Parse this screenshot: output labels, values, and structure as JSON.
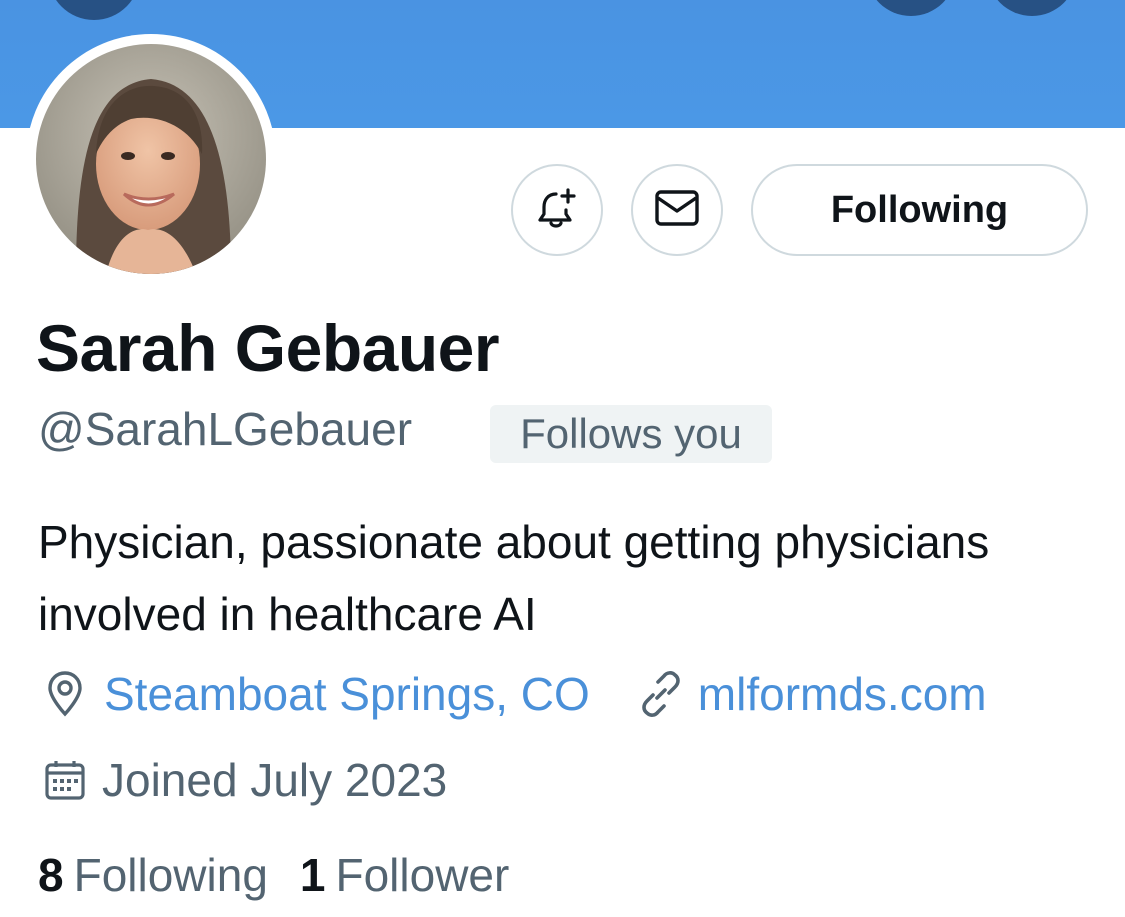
{
  "profile": {
    "name": "Sarah Gebauer",
    "handle": "@SarahLGebauer",
    "follows_you_badge": "Follows you",
    "bio": "Physician, passionate about getting physicians involved in healthcare AI",
    "location": "Steamboat Springs, CO",
    "website": "mlformds.com",
    "joined": "Joined July 2023",
    "following_count": "8",
    "following_label": "Following",
    "followers_count": "1",
    "followers_label": "Follower"
  },
  "actions": {
    "follow_state_label": "Following"
  },
  "icons": {
    "notify": "bell-plus-icon",
    "message": "envelope-icon",
    "location": "map-pin-icon",
    "website": "link-icon",
    "joined": "calendar-icon"
  },
  "colors": {
    "banner": "#4b98e6",
    "link": "#4a90d9",
    "muted_text": "#536471",
    "border": "#cfd9de"
  }
}
